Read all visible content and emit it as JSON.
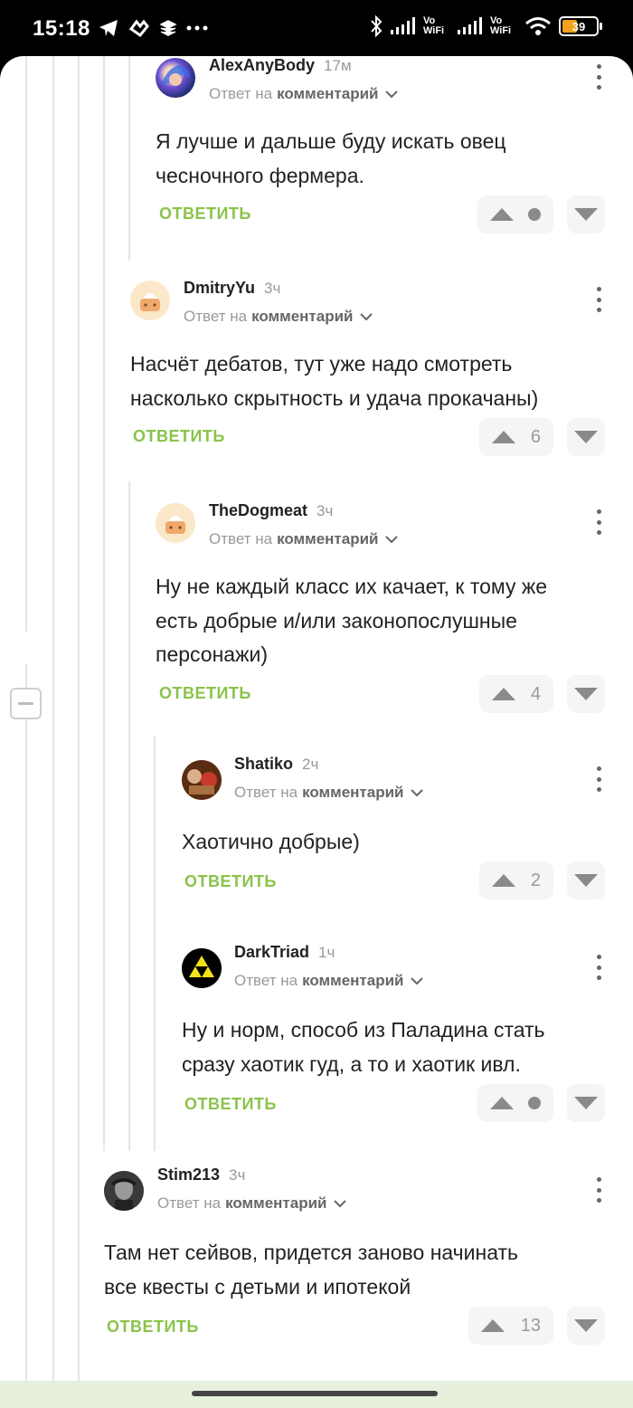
{
  "status_bar": {
    "time": "15:18",
    "left_icons": [
      "telegram-icon",
      "app-icon",
      "stack-icon",
      "more-icon"
    ],
    "right_icons": [
      "bluetooth-icon",
      "signal-icon",
      "signal-icon",
      "wifi-icon"
    ],
    "vo_wifi_1": "Vo WiFi",
    "vo_wifi_2": "Vo WiFi",
    "battery": "39"
  },
  "labels": {
    "reply_prefix": "Ответ на",
    "reply_target": "комментарий",
    "reply_button": "ОТВЕТИТЬ"
  },
  "colors": {
    "accent": "#8ac34a",
    "battery": "#f3a21d"
  },
  "comments": [
    {
      "user": "AlexAnyBody",
      "time": "17м",
      "lines": [
        "Я лучше и дальше буду искать овец",
        "чесночного фермера."
      ],
      "votes": "",
      "avatar": "avatar-anime"
    },
    {
      "user": "DmitryYu",
      "time": "3ч",
      "lines": [
        "Насчёт дебатов, тут уже надо смотреть",
        "насколько скрытность и удача прокачаны)"
      ],
      "votes": "6",
      "avatar": "avatar-default"
    },
    {
      "user": "TheDogmeat",
      "time": "3ч",
      "lines": [
        "Ну не каждый класс их качает, к тому же",
        "есть добрые и/или законопослушные",
        "персонажи)"
      ],
      "votes": "4",
      "avatar": "avatar-default"
    },
    {
      "user": "Shatiko",
      "time": "2ч",
      "lines": [
        "Хаотично добрые)"
      ],
      "votes": "2",
      "avatar": "avatar-mario"
    },
    {
      "user": "DarkTriad",
      "time": "1ч",
      "lines": [
        "Ну и норм, способ из Паладина стать",
        "сразу хаотик гуд, а то и хаотик ивл."
      ],
      "votes": "",
      "avatar": "avatar-triforce"
    },
    {
      "user": "Stim213",
      "time": "3ч",
      "lines": [
        "Там нет сейвов, придется заново начинать",
        "все квесты с детьми и ипотекой"
      ],
      "votes": "13",
      "avatar": "avatar-photo"
    }
  ]
}
